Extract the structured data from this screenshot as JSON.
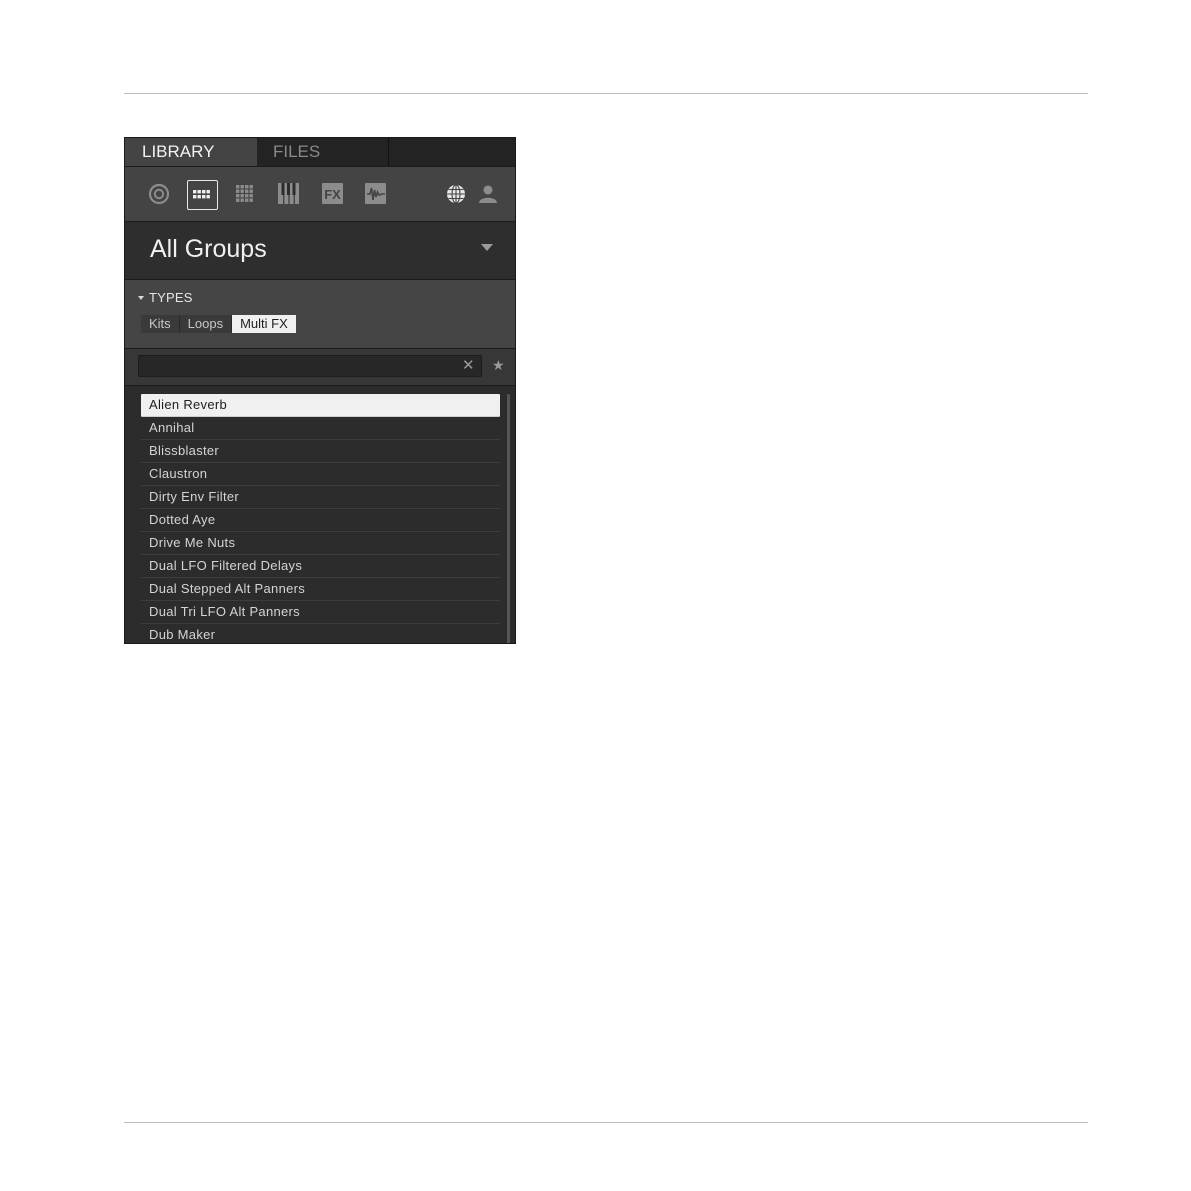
{
  "tabs": [
    {
      "label": "LIBRARY",
      "active": true
    },
    {
      "label": "FILES",
      "active": false
    }
  ],
  "icons": [
    {
      "name": "project-icon",
      "selected": false
    },
    {
      "name": "group-icon",
      "selected": true
    },
    {
      "name": "sound-icon",
      "selected": false
    },
    {
      "name": "instrument-icon",
      "selected": false
    },
    {
      "name": "fx-icon",
      "selected": false
    },
    {
      "name": "sample-icon",
      "selected": false
    },
    {
      "name": "factory-globe-icon",
      "selected": false
    },
    {
      "name": "user-icon",
      "selected": false
    }
  ],
  "content_selector": {
    "title": "All Groups"
  },
  "types": {
    "label": "TYPES",
    "chips": [
      {
        "label": "Kits",
        "active": false
      },
      {
        "label": "Loops",
        "active": false
      },
      {
        "label": "Multi FX",
        "active": true
      }
    ]
  },
  "search": {
    "value": "",
    "placeholder": "",
    "clear_glyph": "✕",
    "favorites_glyph": "★"
  },
  "results": {
    "selected_index": 0,
    "items": [
      "Alien Reverb",
      "Annihal",
      "Blissblaster",
      "Claustron",
      "Dirty Env Filter",
      "Dotted Aye",
      "Drive Me Nuts",
      "Dual LFO Filtered Delays",
      "Dual Stepped Alt Panners",
      "Dual Tri LFO Alt Panners",
      "Dub Maker"
    ]
  },
  "colors": {
    "panel": "#2c2c2c",
    "header": "#444444",
    "selected": "#f0f0f0",
    "text": "#d4d4d4"
  }
}
